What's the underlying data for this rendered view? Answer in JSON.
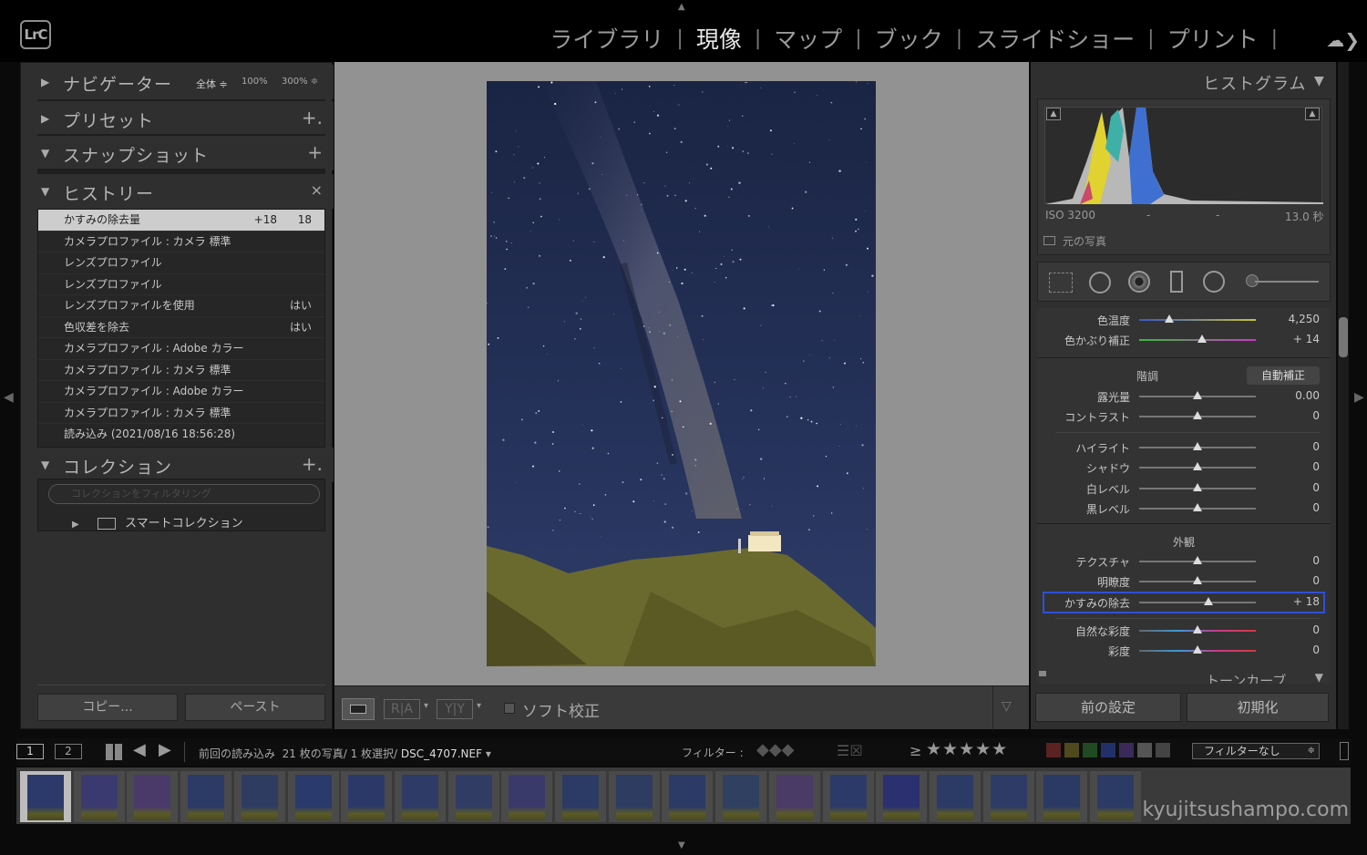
{
  "app": {
    "logo": "LrC"
  },
  "modules": [
    {
      "label": "ライブラリ",
      "active": false
    },
    {
      "label": "現像",
      "active": true
    },
    {
      "label": "マップ",
      "active": false
    },
    {
      "label": "ブック",
      "active": false
    },
    {
      "label": "スライドショー",
      "active": false
    },
    {
      "label": "プリント",
      "active": false
    }
  ],
  "module_separator": "|",
  "left": {
    "navigator": {
      "title": "ナビゲーター",
      "zoom_fit": "全体 ≑",
      "zoom_100": "100%",
      "zoom_300": "300% ≑"
    },
    "presets": {
      "title": "プリセット",
      "add": "+."
    },
    "snapshots": {
      "title": "スナップショット",
      "add": "+"
    },
    "history": {
      "title": "ヒストリー",
      "clear": "×",
      "items": [
        {
          "label": "かすみの除去量",
          "v1": "+18",
          "v2": "18"
        },
        {
          "label": "カメラプロファイル : カメラ 標準",
          "v1": "",
          "v2": ""
        },
        {
          "label": "レンズプロファイル",
          "v1": "",
          "v2": ""
        },
        {
          "label": "レンズプロファイル",
          "v1": "",
          "v2": ""
        },
        {
          "label": "レンズプロファイルを使用",
          "v1": "",
          "v2": "はい"
        },
        {
          "label": "色収差を除去",
          "v1": "",
          "v2": "はい"
        },
        {
          "label": "カメラプロファイル : Adobe カラー",
          "v1": "",
          "v2": ""
        },
        {
          "label": "カメラプロファイル : カメラ 標準",
          "v1": "",
          "v2": ""
        },
        {
          "label": "カメラプロファイル : Adobe カラー",
          "v1": "",
          "v2": ""
        },
        {
          "label": "カメラプロファイル : カメラ 標準",
          "v1": "",
          "v2": ""
        },
        {
          "label": "読み込み (2021/08/16 18:56:28)",
          "v1": "",
          "v2": ""
        }
      ]
    },
    "collections": {
      "title": "コレクション",
      "add": "+.",
      "search_placeholder": "コレクションをフィルタリング",
      "smart": "スマートコレクション"
    },
    "copy_button": "コピー...",
    "paste_button": "ペースト"
  },
  "toolbar": {
    "soft_proof": "ソフト校正",
    "ra": "R|A",
    "yy": "Y|Y"
  },
  "right": {
    "histogram": {
      "title": "ヒストグラム",
      "iso": "ISO 3200",
      "dash1": "-",
      "dash2": "-",
      "shutter": "13.0 秒",
      "original": "元の写真"
    },
    "basic": {
      "temp": {
        "label": "色温度",
        "value": "4,250",
        "pos": 0.26
      },
      "tint": {
        "label": "色かぶり補正",
        "value": "+ 14",
        "pos": 0.54
      },
      "tone_head": "階調",
      "auto": "自動補正",
      "tone": [
        {
          "label": "露光量",
          "value": "0.00",
          "pos": 0.5
        },
        {
          "label": "コントラスト",
          "value": "0",
          "pos": 0.5
        }
      ],
      "tone2": [
        {
          "label": "ハイライト",
          "value": "0",
          "pos": 0.5
        },
        {
          "label": "シャドウ",
          "value": "0",
          "pos": 0.5
        },
        {
          "label": "白レベル",
          "value": "0",
          "pos": 0.5
        },
        {
          "label": "黒レベル",
          "value": "0",
          "pos": 0.5
        }
      ],
      "presence_head": "外観",
      "presence": [
        {
          "label": "テクスチャ",
          "value": "0",
          "pos": 0.5
        },
        {
          "label": "明瞭度",
          "value": "0",
          "pos": 0.5
        },
        {
          "label": "かすみの除去",
          "value": "+ 18",
          "pos": 0.59
        }
      ],
      "color": [
        {
          "label": "自然な彩度",
          "value": "0",
          "pos": 0.5
        },
        {
          "label": "彩度",
          "value": "0",
          "pos": 0.5
        }
      ],
      "tone_curve": "トーンカーブ"
    },
    "prev_button": "前の設定",
    "reset_button": "初期化"
  },
  "filmbar": {
    "view1": "1",
    "view2": "2",
    "path_prefix": "前回の読み込み",
    "count": "21 枚の写真/ 1 枚選択/",
    "filename": "DSC_4707.NEF",
    "filter_label": "フィルター :",
    "rating_op": "≥",
    "stars": "★★★★★",
    "filter_select": "フィルターなし"
  },
  "watermark": "kyujitsushampo.com",
  "colors": {
    "accent_blue": "#2f4fd8",
    "selected": "#cdcdcd"
  }
}
